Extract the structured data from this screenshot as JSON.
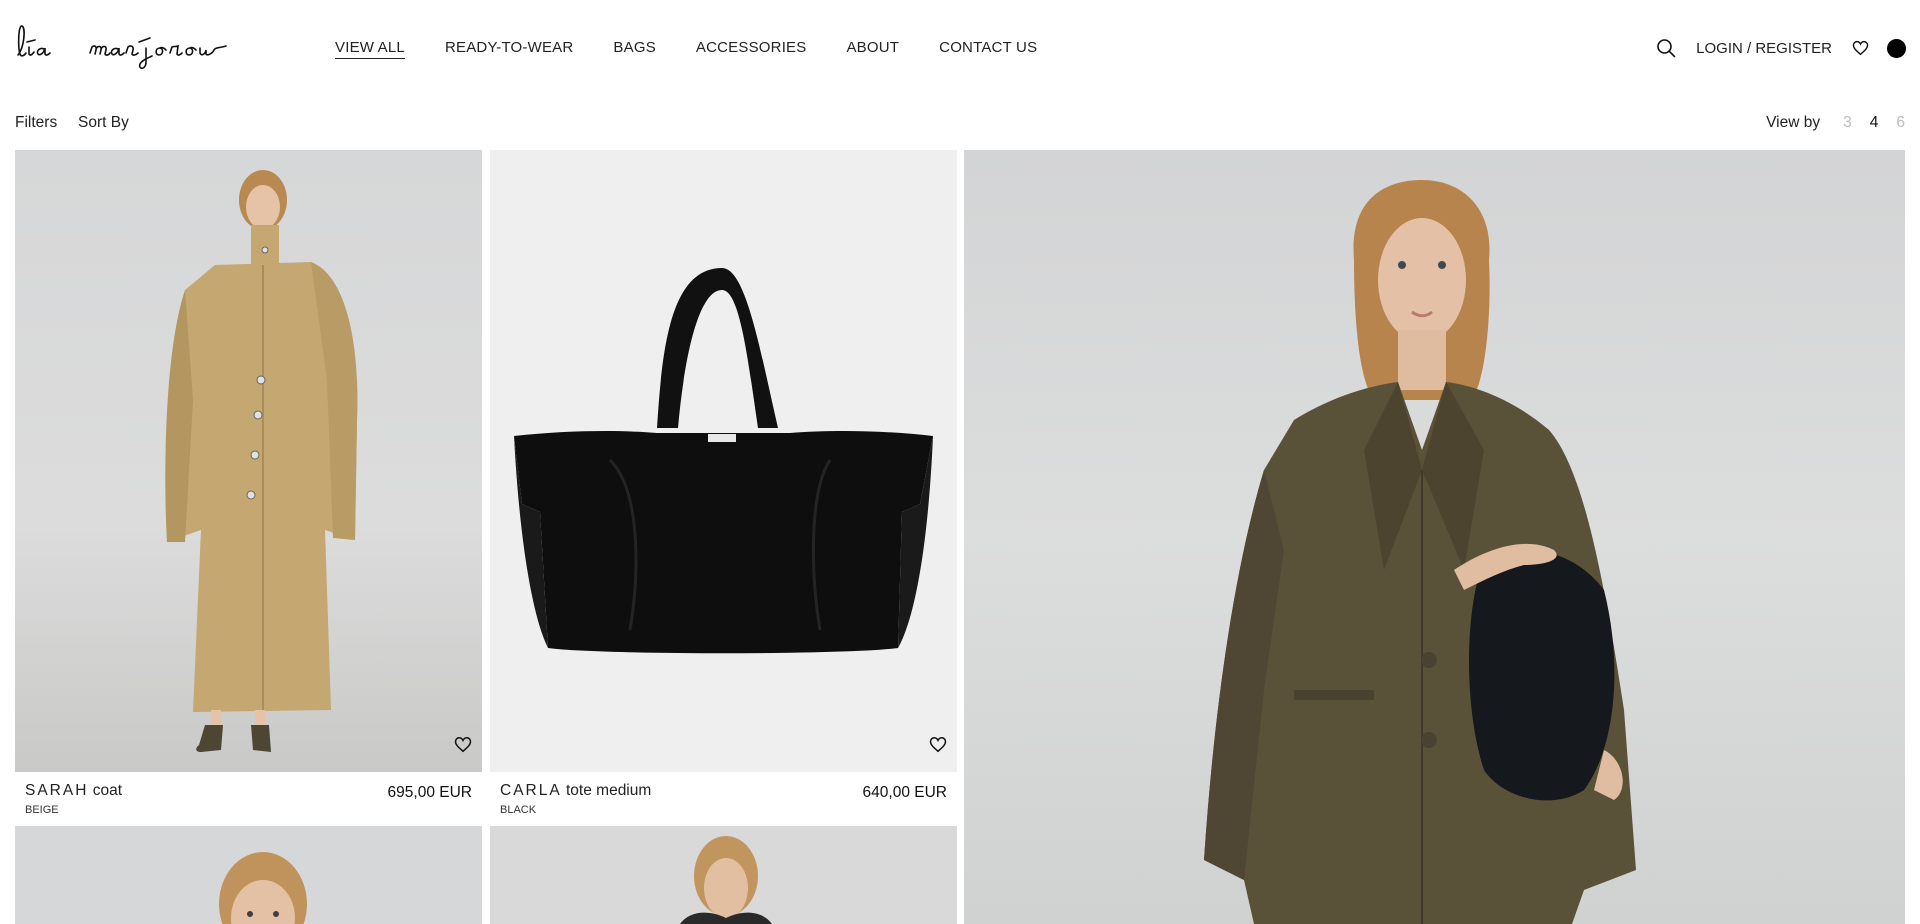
{
  "header": {
    "logo_text": "lia manjorou",
    "nav": [
      {
        "label": "VIEW ALL",
        "active": true
      },
      {
        "label": "READY-TO-WEAR",
        "active": false
      },
      {
        "label": "BAGS",
        "active": false
      },
      {
        "label": "ACCESSORIES",
        "active": false
      },
      {
        "label": "ABOUT",
        "active": false
      },
      {
        "label": "CONTACT US",
        "active": false
      }
    ],
    "login_label": "LOGIN / REGISTER",
    "icons": [
      "search-icon",
      "heart-icon",
      "account-icon"
    ]
  },
  "toolbar": {
    "filters_label": "Filters",
    "sort_label": "Sort By",
    "viewby_label": "View by",
    "viewby_options": [
      "3",
      "4",
      "6"
    ],
    "viewby_selected": "4"
  },
  "products": [
    {
      "name_caps": "SARAH",
      "name_rest": "coat",
      "color": "BEIGE",
      "price": "695,00 EUR"
    },
    {
      "name_caps": "CARLA",
      "name_rest": "tote medium",
      "color": "BLACK",
      "price": "640,00 EUR"
    }
  ],
  "colors": {
    "text": "#222222",
    "image_bg_gray": "#d9dadb",
    "image_bg_light": "#efefef",
    "coat": "#c4a771",
    "bag": "#0e0e0e",
    "blazer": "#5a5139"
  }
}
